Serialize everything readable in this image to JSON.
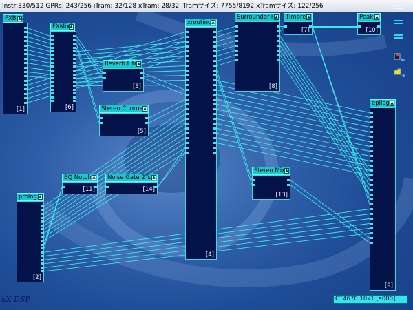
{
  "status_text": "Instr:330/512 GPRs: 243/256 iTram: 32/128 xTram: 28/32 iTramサイズ: 7755/8192 xTramサイズ: 122/256",
  "modules": [
    {
      "name": "FXBus",
      "id": "[1]"
    },
    {
      "name": "FXMix2",
      "id": "[6]"
    },
    {
      "name": "Reverb Lite",
      "id": "[3]"
    },
    {
      "name": "Stereo Chorus",
      "id": "[5]"
    },
    {
      "name": "xrouting",
      "id": "[4]"
    },
    {
      "name": "Surrounder+",
      "id": "[8]"
    },
    {
      "name": "Timbre",
      "id": "[7]"
    },
    {
      "name": "Peak",
      "id": "[10]"
    },
    {
      "name": "epilog",
      "id": "[9]"
    },
    {
      "name": "Stereo Mix",
      "id": "[13]"
    },
    {
      "name": "EQ Notch",
      "id": "[11]"
    },
    {
      "name": "Noise Gate 2Ts",
      "id": "[14]"
    },
    {
      "name": "prolog",
      "id": "[2]"
    }
  ],
  "logo_text": "kX DSP",
  "hardware_label": "CT4670 10k1 [a000]",
  "colors": {
    "module_body": "#04124a",
    "title_bar": "#19c7cf",
    "wire": "#3ee6ee",
    "background": "#2f5fa8"
  },
  "icons": [
    "menu-icon",
    "menu-icon-2",
    "menu-icon-3",
    "load-preset-icon",
    "save-preset-icon"
  ]
}
